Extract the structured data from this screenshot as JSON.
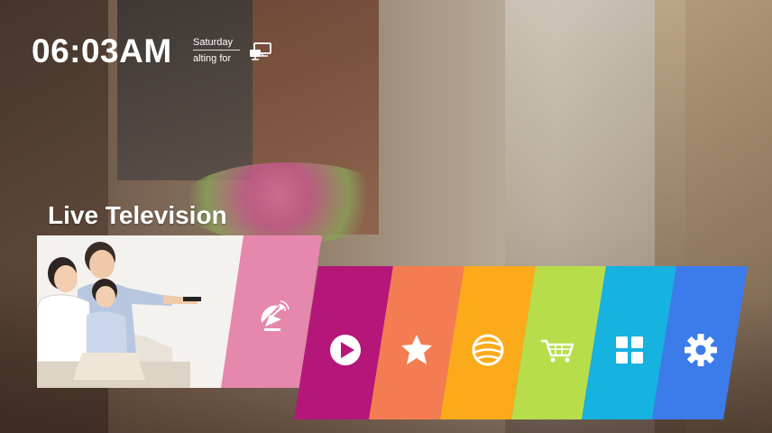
{
  "status_bar": {
    "time": "06:03AM",
    "day": "Saturday",
    "subtext": "alting for",
    "network_icon": "network-computer-icon"
  },
  "main": {
    "section_title": "Live Television",
    "preview_image": "family-watching-tv-image"
  },
  "tiles": [
    {
      "id": "live-tv",
      "icon": "satellite-dish-icon",
      "color": "#e687ad"
    },
    {
      "id": "media-player",
      "icon": "play-circle-icon",
      "color": "#b5167a"
    },
    {
      "id": "favorites",
      "icon": "star-icon",
      "color": "#f47c52"
    },
    {
      "id": "browser",
      "icon": "globe-icon",
      "color": "#fbaa1a"
    },
    {
      "id": "store",
      "icon": "shopping-cart-icon",
      "color": "#b8dd4b"
    },
    {
      "id": "apps",
      "icon": "apps-grid-icon",
      "color": "#16b2e0"
    },
    {
      "id": "settings",
      "icon": "gear-icon",
      "color": "#3c7bea"
    }
  ]
}
